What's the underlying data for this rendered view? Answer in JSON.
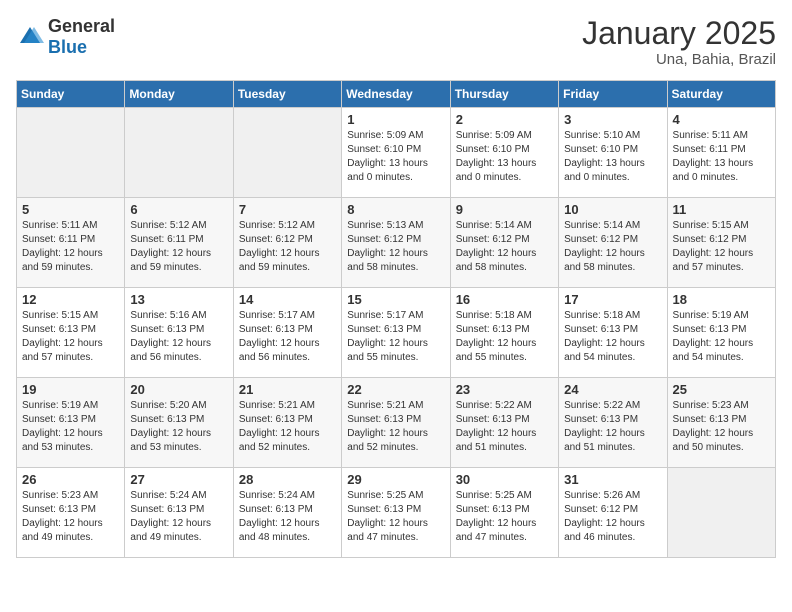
{
  "header": {
    "logo": {
      "general": "General",
      "blue": "Blue"
    },
    "title": "January 2025",
    "location": "Una, Bahia, Brazil"
  },
  "calendar": {
    "days_of_week": [
      "Sunday",
      "Monday",
      "Tuesday",
      "Wednesday",
      "Thursday",
      "Friday",
      "Saturday"
    ],
    "weeks": [
      [
        null,
        null,
        null,
        {
          "date": "1",
          "sunrise": "Sunrise: 5:09 AM",
          "sunset": "Sunset: 6:10 PM",
          "daylight": "Daylight: 13 hours and 0 minutes."
        },
        {
          "date": "2",
          "sunrise": "Sunrise: 5:09 AM",
          "sunset": "Sunset: 6:10 PM",
          "daylight": "Daylight: 13 hours and 0 minutes."
        },
        {
          "date": "3",
          "sunrise": "Sunrise: 5:10 AM",
          "sunset": "Sunset: 6:10 PM",
          "daylight": "Daylight: 13 hours and 0 minutes."
        },
        {
          "date": "4",
          "sunrise": "Sunrise: 5:11 AM",
          "sunset": "Sunset: 6:11 PM",
          "daylight": "Daylight: 13 hours and 0 minutes."
        }
      ],
      [
        {
          "date": "5",
          "sunrise": "Sunrise: 5:11 AM",
          "sunset": "Sunset: 6:11 PM",
          "daylight": "Daylight: 12 hours and 59 minutes."
        },
        {
          "date": "6",
          "sunrise": "Sunrise: 5:12 AM",
          "sunset": "Sunset: 6:11 PM",
          "daylight": "Daylight: 12 hours and 59 minutes."
        },
        {
          "date": "7",
          "sunrise": "Sunrise: 5:12 AM",
          "sunset": "Sunset: 6:12 PM",
          "daylight": "Daylight: 12 hours and 59 minutes."
        },
        {
          "date": "8",
          "sunrise": "Sunrise: 5:13 AM",
          "sunset": "Sunset: 6:12 PM",
          "daylight": "Daylight: 12 hours and 58 minutes."
        },
        {
          "date": "9",
          "sunrise": "Sunrise: 5:14 AM",
          "sunset": "Sunset: 6:12 PM",
          "daylight": "Daylight: 12 hours and 58 minutes."
        },
        {
          "date": "10",
          "sunrise": "Sunrise: 5:14 AM",
          "sunset": "Sunset: 6:12 PM",
          "daylight": "Daylight: 12 hours and 58 minutes."
        },
        {
          "date": "11",
          "sunrise": "Sunrise: 5:15 AM",
          "sunset": "Sunset: 6:12 PM",
          "daylight": "Daylight: 12 hours and 57 minutes."
        }
      ],
      [
        {
          "date": "12",
          "sunrise": "Sunrise: 5:15 AM",
          "sunset": "Sunset: 6:13 PM",
          "daylight": "Daylight: 12 hours and 57 minutes."
        },
        {
          "date": "13",
          "sunrise": "Sunrise: 5:16 AM",
          "sunset": "Sunset: 6:13 PM",
          "daylight": "Daylight: 12 hours and 56 minutes."
        },
        {
          "date": "14",
          "sunrise": "Sunrise: 5:17 AM",
          "sunset": "Sunset: 6:13 PM",
          "daylight": "Daylight: 12 hours and 56 minutes."
        },
        {
          "date": "15",
          "sunrise": "Sunrise: 5:17 AM",
          "sunset": "Sunset: 6:13 PM",
          "daylight": "Daylight: 12 hours and 55 minutes."
        },
        {
          "date": "16",
          "sunrise": "Sunrise: 5:18 AM",
          "sunset": "Sunset: 6:13 PM",
          "daylight": "Daylight: 12 hours and 55 minutes."
        },
        {
          "date": "17",
          "sunrise": "Sunrise: 5:18 AM",
          "sunset": "Sunset: 6:13 PM",
          "daylight": "Daylight: 12 hours and 54 minutes."
        },
        {
          "date": "18",
          "sunrise": "Sunrise: 5:19 AM",
          "sunset": "Sunset: 6:13 PM",
          "daylight": "Daylight: 12 hours and 54 minutes."
        }
      ],
      [
        {
          "date": "19",
          "sunrise": "Sunrise: 5:19 AM",
          "sunset": "Sunset: 6:13 PM",
          "daylight": "Daylight: 12 hours and 53 minutes."
        },
        {
          "date": "20",
          "sunrise": "Sunrise: 5:20 AM",
          "sunset": "Sunset: 6:13 PM",
          "daylight": "Daylight: 12 hours and 53 minutes."
        },
        {
          "date": "21",
          "sunrise": "Sunrise: 5:21 AM",
          "sunset": "Sunset: 6:13 PM",
          "daylight": "Daylight: 12 hours and 52 minutes."
        },
        {
          "date": "22",
          "sunrise": "Sunrise: 5:21 AM",
          "sunset": "Sunset: 6:13 PM",
          "daylight": "Daylight: 12 hours and 52 minutes."
        },
        {
          "date": "23",
          "sunrise": "Sunrise: 5:22 AM",
          "sunset": "Sunset: 6:13 PM",
          "daylight": "Daylight: 12 hours and 51 minutes."
        },
        {
          "date": "24",
          "sunrise": "Sunrise: 5:22 AM",
          "sunset": "Sunset: 6:13 PM",
          "daylight": "Daylight: 12 hours and 51 minutes."
        },
        {
          "date": "25",
          "sunrise": "Sunrise: 5:23 AM",
          "sunset": "Sunset: 6:13 PM",
          "daylight": "Daylight: 12 hours and 50 minutes."
        }
      ],
      [
        {
          "date": "26",
          "sunrise": "Sunrise: 5:23 AM",
          "sunset": "Sunset: 6:13 PM",
          "daylight": "Daylight: 12 hours and 49 minutes."
        },
        {
          "date": "27",
          "sunrise": "Sunrise: 5:24 AM",
          "sunset": "Sunset: 6:13 PM",
          "daylight": "Daylight: 12 hours and 49 minutes."
        },
        {
          "date": "28",
          "sunrise": "Sunrise: 5:24 AM",
          "sunset": "Sunset: 6:13 PM",
          "daylight": "Daylight: 12 hours and 48 minutes."
        },
        {
          "date": "29",
          "sunrise": "Sunrise: 5:25 AM",
          "sunset": "Sunset: 6:13 PM",
          "daylight": "Daylight: 12 hours and 47 minutes."
        },
        {
          "date": "30",
          "sunrise": "Sunrise: 5:25 AM",
          "sunset": "Sunset: 6:13 PM",
          "daylight": "Daylight: 12 hours and 47 minutes."
        },
        {
          "date": "31",
          "sunrise": "Sunrise: 5:26 AM",
          "sunset": "Sunset: 6:12 PM",
          "daylight": "Daylight: 12 hours and 46 minutes."
        },
        null
      ]
    ]
  }
}
